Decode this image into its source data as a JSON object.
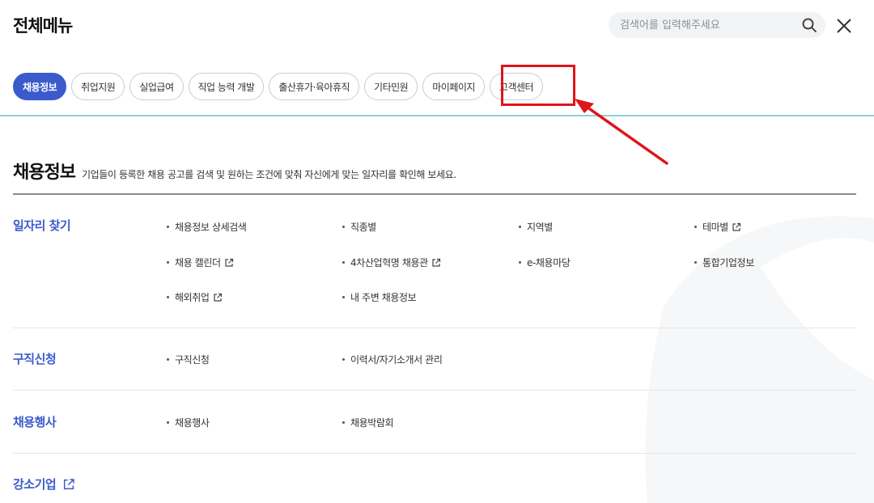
{
  "header": {
    "title": "전체메뉴",
    "search_placeholder": "검색어를 입력해주세요"
  },
  "tabs": [
    {
      "label": "채용정보",
      "active": true
    },
    {
      "label": "취업지원"
    },
    {
      "label": "실업급여"
    },
    {
      "label": "직업 능력 개발"
    },
    {
      "label": "출산휴가·육아휴직"
    },
    {
      "label": "기타민원"
    },
    {
      "label": "마이페이지"
    },
    {
      "label": "고객센터",
      "highlighted": true
    }
  ],
  "section": {
    "title": "채용정보",
    "description": "기업들이 등록한 채용 공고를 검색 및 원하는 조건에 맞춰 자신에게 맞는 일자리를 확인해 보세요."
  },
  "categories": [
    {
      "title": "일자리 찾기",
      "links": [
        {
          "label": "채용정보 상세검색"
        },
        {
          "label": "직종별"
        },
        {
          "label": "지역별"
        },
        {
          "label": "테마별",
          "external": true
        },
        {
          "label": "채용 캘린더",
          "external": true
        },
        {
          "label": "4차산업혁명 채용관",
          "external": true
        },
        {
          "label": "e-채용마당"
        },
        {
          "label": "통합기업정보"
        },
        {
          "label": "해외취업",
          "external": true
        },
        {
          "label": "내 주변 채용정보"
        }
      ]
    },
    {
      "title": "구직신청",
      "links": [
        {
          "label": "구직신청"
        },
        {
          "label": "이력서/자기소개서 관리"
        }
      ]
    },
    {
      "title": "채용행사",
      "links": [
        {
          "label": "채용행사"
        },
        {
          "label": "채용박람회"
        }
      ]
    },
    {
      "title": "강소기업",
      "external": true,
      "links": []
    }
  ],
  "colors": {
    "accent": "#3b5bcc",
    "highlight": "#e0141b",
    "divider": "#8fcfd6"
  },
  "icons": {
    "search": "search-icon",
    "close": "close-icon",
    "external": "external-link-icon"
  }
}
